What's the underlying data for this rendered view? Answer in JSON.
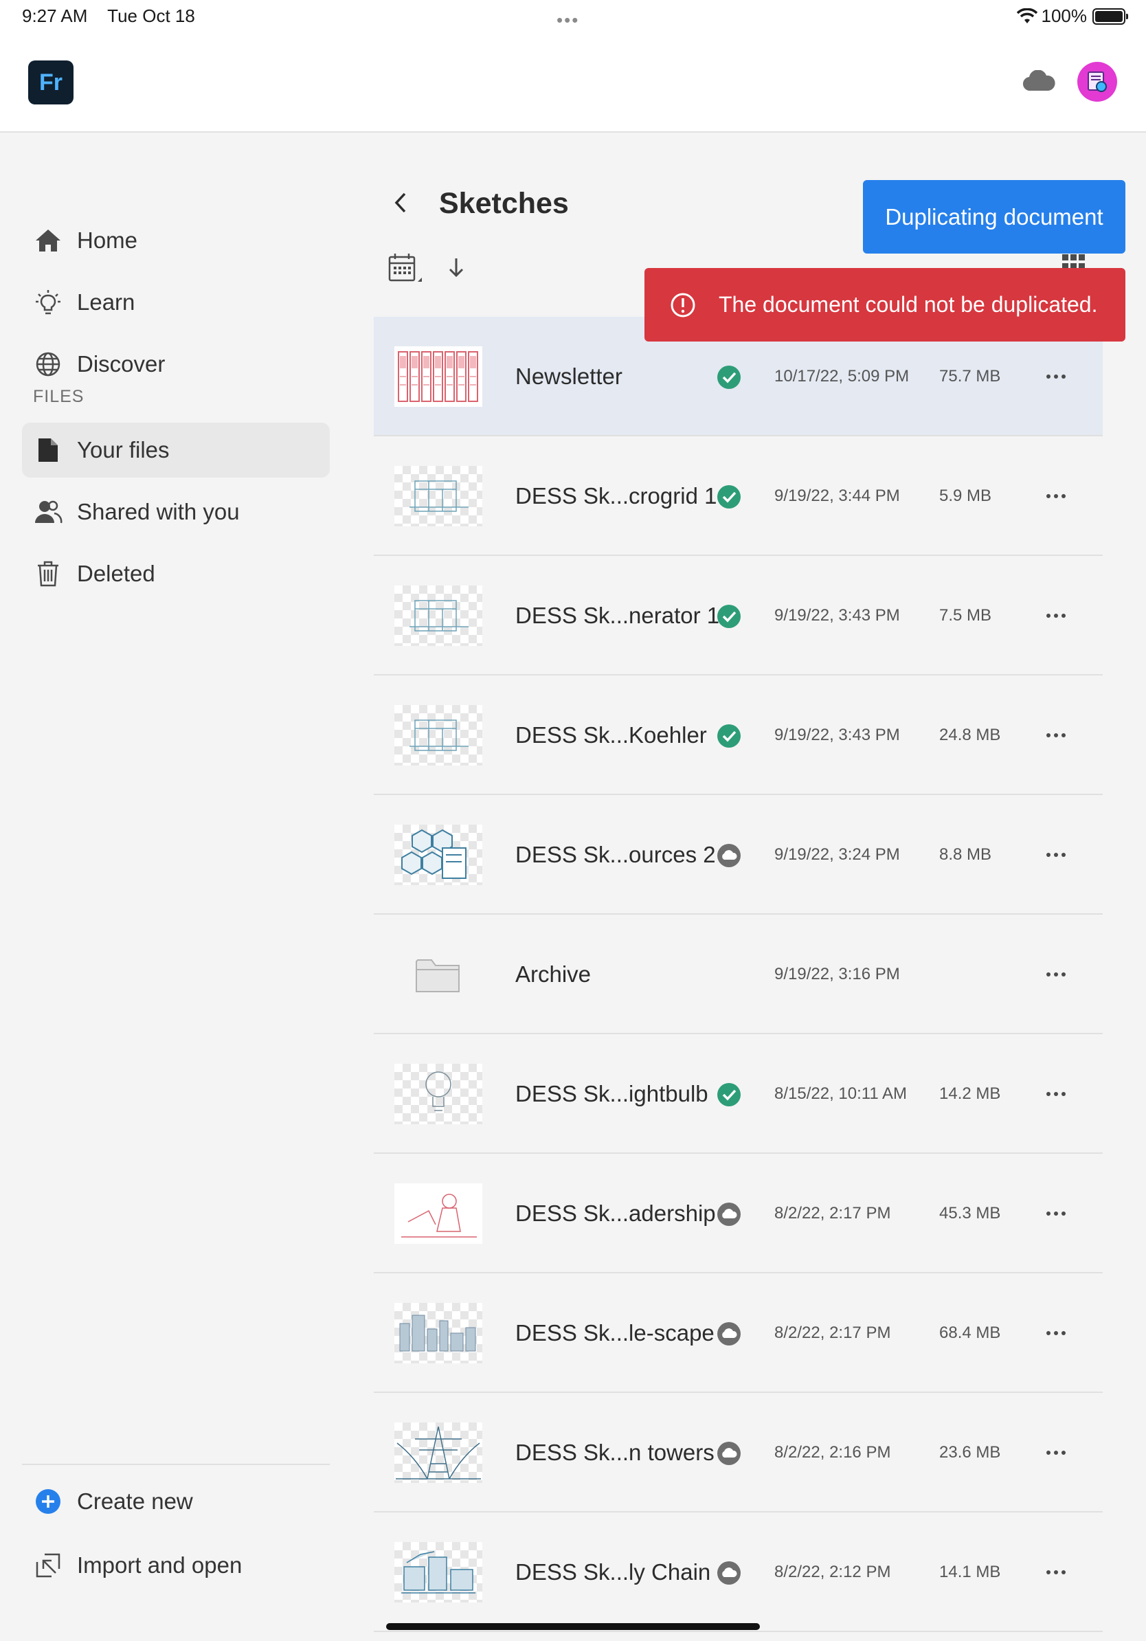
{
  "status_bar": {
    "time": "9:27 AM",
    "date": "Tue Oct 18",
    "dots": "•••",
    "battery": "100%"
  },
  "app": {
    "logo_text": "Fr"
  },
  "sidebar": {
    "items": [
      {
        "label": "Home",
        "icon": "home-icon"
      },
      {
        "label": "Learn",
        "icon": "lightbulb-icon"
      },
      {
        "label": "Discover",
        "icon": "globe-icon"
      }
    ],
    "section_label": "FILES",
    "file_items": [
      {
        "label": "Your files",
        "icon": "document-icon",
        "active": true
      },
      {
        "label": "Shared with you",
        "icon": "people-icon"
      },
      {
        "label": "Deleted",
        "icon": "trash-icon"
      }
    ],
    "bottom_items": [
      {
        "label": "Create new",
        "icon": "plus-circle-icon"
      },
      {
        "label": "Import and open",
        "icon": "import-icon"
      }
    ]
  },
  "main": {
    "title": "Sketches",
    "files": [
      {
        "name": "Newsletter",
        "date": "10/17/22, 5:09 PM",
        "size": "75.7 MB",
        "status": "synced",
        "selected": true,
        "thumb": "newsletter"
      },
      {
        "name": "DESS Sk...crogrid 1",
        "date": "9/19/22, 3:44 PM",
        "size": "5.9 MB",
        "status": "synced",
        "thumb": "sketch"
      },
      {
        "name": "DESS Sk...nerator 1",
        "date": "9/19/22, 3:43 PM",
        "size": "7.5 MB",
        "status": "synced",
        "thumb": "sketch"
      },
      {
        "name": "DESS Sk...Koehler",
        "date": "9/19/22, 3:43 PM",
        "size": "24.8 MB",
        "status": "synced",
        "thumb": "sketch"
      },
      {
        "name": "DESS Sk...ources 2",
        "date": "9/19/22, 3:24 PM",
        "size": "8.8 MB",
        "status": "cloud",
        "thumb": "hex"
      },
      {
        "name": "Archive",
        "date": "9/19/22, 3:16 PM",
        "size": "",
        "status": "",
        "thumb": "folder"
      },
      {
        "name": "DESS Sk...ightbulb",
        "date": "8/15/22, 10:11 AM",
        "size": "14.2 MB",
        "status": "synced",
        "thumb": "bulb"
      },
      {
        "name": "DESS Sk...adership",
        "date": "8/2/22, 2:17 PM",
        "size": "45.3 MB",
        "status": "cloud",
        "thumb": "red"
      },
      {
        "name": "DESS Sk...le-scape",
        "date": "8/2/22, 2:17 PM",
        "size": "68.4 MB",
        "status": "cloud",
        "thumb": "city"
      },
      {
        "name": "DESS Sk...n towers",
        "date": "8/2/22, 2:16 PM",
        "size": "23.6 MB",
        "status": "cloud",
        "thumb": "tower"
      },
      {
        "name": "DESS Sk...ly Chain",
        "date": "8/2/22, 2:12 PM",
        "size": "14.1 MB",
        "status": "cloud",
        "thumb": "chain"
      }
    ]
  },
  "toasts": {
    "progress": "Duplicating document",
    "error": "The document could not be duplicated."
  },
  "colors": {
    "accent_blue": "#2680eb",
    "error_red": "#d7373f",
    "synced_green": "#2d9d78",
    "selected_row": "#e4e9f2"
  }
}
